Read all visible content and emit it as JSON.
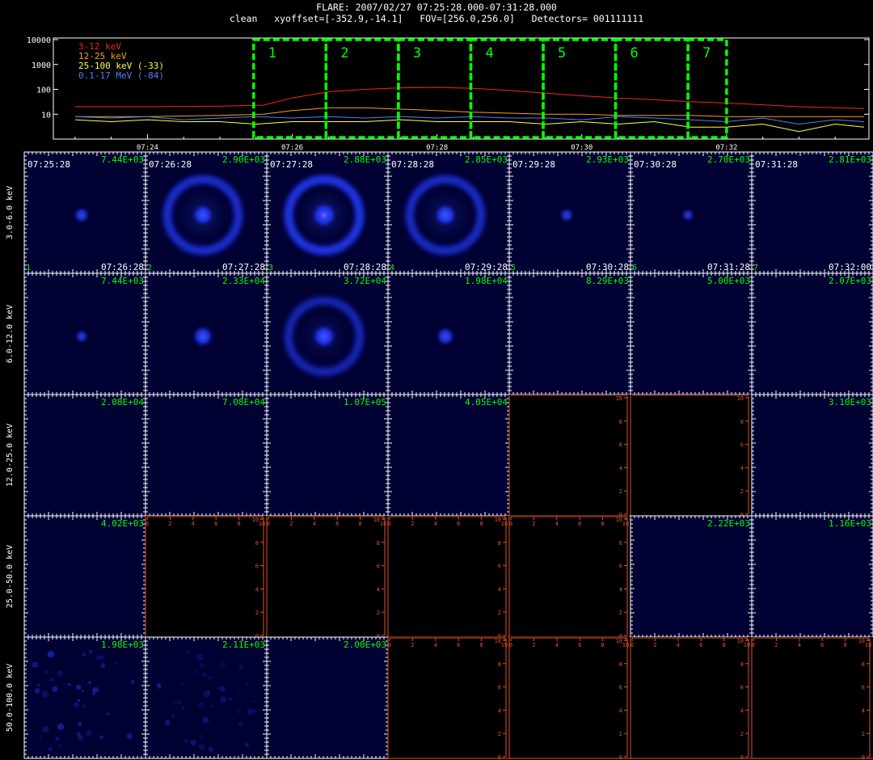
{
  "header": {
    "title": "FLARE: 2007/02/27 07:25:28.000-07:31:28.000",
    "subtitle": "clean   xyoffset=[-352.9,-14.1]   FOV=[256.0,256.0]   Detectors= 001111111"
  },
  "colors": {
    "background": "#000000",
    "panel_bg": "#000033",
    "empty_axis": "#e0522a",
    "interval_box": "#00ff00",
    "peak_label": "#00ff00",
    "time_label": "#ffffff"
  },
  "chart_data": [
    {
      "type": "line",
      "name": "lightcurve",
      "y_scale": "log",
      "ylim": [
        1,
        10000
      ],
      "y_ticks": [
        "10000",
        "1000",
        "100",
        "10"
      ],
      "x_ticks": [
        "07:24",
        "07:26",
        "07:28",
        "07:30",
        "07:32"
      ],
      "legend_placement": "top-left",
      "series": [
        {
          "name": "3-12 keV",
          "color": "#ff2020",
          "x": [
            "07:23.0",
            "07:24.0",
            "07:25.0",
            "07:25.6",
            "07:26.0",
            "07:26.5",
            "07:27.0",
            "07:27.5",
            "07:28.0",
            "07:28.5",
            "07:29.0",
            "07:29.5",
            "07:30.0",
            "07:30.5",
            "07:31.0",
            "07:31.5",
            "07:32.0",
            "07:32.5",
            "07:33.0",
            "07:33.9"
          ],
          "y": [
            20,
            20,
            21,
            23,
            45,
            80,
            100,
            115,
            120,
            110,
            90,
            70,
            55,
            45,
            38,
            32,
            28,
            24,
            20,
            17
          ]
        },
        {
          "name": "12-25 keV",
          "color": "#f0a020",
          "x": [
            "07:23.0",
            "07:24.0",
            "07:25.0",
            "07:25.6",
            "07:26.0",
            "07:26.5",
            "07:27.0",
            "07:27.5",
            "07:28.0",
            "07:28.5",
            "07:29.0",
            "07:29.5",
            "07:30.0",
            "07:30.5",
            "07:31.0",
            "07:31.5",
            "07:32.0",
            "07:32.5",
            "07:33.0",
            "07:33.9"
          ],
          "y": [
            8,
            8,
            9,
            10,
            14,
            18,
            18,
            16,
            14,
            12,
            11,
            10,
            10,
            9,
            9,
            9,
            8,
            8,
            8,
            8
          ]
        },
        {
          "name": "25-100 keV (-33)",
          "color": "#ffff40",
          "x": [
            "07:23.0",
            "07:23.5",
            "07:24.0",
            "07:24.5",
            "07:25.0",
            "07:25.5",
            "07:26.0",
            "07:26.5",
            "07:27.0",
            "07:27.5",
            "07:28.0",
            "07:28.5",
            "07:29.0",
            "07:29.5",
            "07:30.0",
            "07:30.5",
            "07:31.0",
            "07:31.5",
            "07:32.0",
            "07:32.5",
            "07:33.0",
            "07:33.5",
            "07:33.9"
          ],
          "y": [
            6,
            5,
            6,
            5,
            5,
            4,
            5,
            5,
            5,
            6,
            5,
            5,
            5,
            4,
            5,
            4,
            5,
            3,
            3,
            4,
            2,
            4,
            3
          ]
        },
        {
          "name": "0.1-17 MeV (-84)",
          "color": "#4a80ff",
          "x": [
            "07:23.0",
            "07:23.5",
            "07:24.0",
            "07:24.5",
            "07:25.0",
            "07:25.5",
            "07:26.0",
            "07:26.5",
            "07:27.0",
            "07:27.5",
            "07:28.0",
            "07:28.5",
            "07:29.0",
            "07:29.5",
            "07:30.0",
            "07:30.5",
            "07:31.0",
            "07:31.5",
            "07:32.0",
            "07:32.5",
            "07:33.0",
            "07:33.5",
            "07:33.9"
          ],
          "y": [
            8,
            7,
            8,
            6,
            7,
            8,
            7,
            8,
            7,
            8,
            7,
            8,
            7,
            7,
            6,
            8,
            7,
            6,
            5,
            7,
            4,
            6,
            5
          ]
        }
      ],
      "intervals": [
        {
          "label": "1",
          "start": "07:25:28",
          "end": "07:26:28"
        },
        {
          "label": "2",
          "start": "07:26:28",
          "end": "07:27:28"
        },
        {
          "label": "3",
          "start": "07:27:28",
          "end": "07:28:28"
        },
        {
          "label": "4",
          "start": "07:28:28",
          "end": "07:29:28"
        },
        {
          "label": "5",
          "start": "07:29:28",
          "end": "07:30:28"
        },
        {
          "label": "6",
          "start": "07:30:28",
          "end": "07:31:28"
        },
        {
          "label": "7",
          "start": "07:31:28",
          "end": "07:32:00"
        }
      ]
    },
    {
      "type": "heatmap",
      "name": "image_grid",
      "rows": [
        "3.0-6.0 keV",
        "6.0-12.0 keV",
        "12.0-25.0 keV",
        "25.0-50.0 keV",
        "50.0-100.0 keV"
      ],
      "columns": [
        "07:25:28",
        "07:26:28",
        "07:27:28",
        "07:28:28",
        "07:29:28",
        "07:30:28",
        "07:31:28"
      ],
      "end_times": [
        "07:26:28",
        "07:27:28",
        "07:28:28",
        "07:29:28",
        "07:30:28",
        "07:31:28",
        "07:32:00"
      ],
      "interval_numbers": [
        "1",
        "2",
        "3",
        "4",
        "5",
        "6",
        "7"
      ],
      "empty_axis_ticks": [
        "0",
        "2",
        "4",
        "6",
        "8",
        "10"
      ],
      "cells": [
        [
          {
            "peak": "7.44E+03",
            "src": 0.45,
            "ring": 0
          },
          {
            "peak": "2.90E+03",
            "src": 0.8,
            "ring": 0.75
          },
          {
            "peak": "2.88E+03",
            "src": 1.0,
            "ring": 0.9
          },
          {
            "peak": "2.85E+03",
            "src": 0.85,
            "ring": 0.7
          },
          {
            "peak": "2.93E+03",
            "src": 0.35,
            "ring": 0
          },
          {
            "peak": "2.70E+03",
            "src": 0.25,
            "ring": 0
          },
          {
            "peak": "2.81E+03",
            "src": 0,
            "ring": 0
          }
        ],
        [
          {
            "peak": "7.44E+03",
            "src": 0.3,
            "ring": 0
          },
          {
            "peak": "2.33E+04",
            "src": 0.75,
            "ring": 0
          },
          {
            "peak": "3.72E+04",
            "src": 0.9,
            "ring": 0.6
          },
          {
            "peak": "1.98E+04",
            "src": 0.6,
            "ring": 0
          },
          {
            "peak": "8.29E+03",
            "src": 0,
            "ring": 0
          },
          {
            "peak": "5.00E+03",
            "src": 0,
            "ring": 0
          },
          {
            "peak": "2.07E+03",
            "src": 0,
            "ring": 0
          }
        ],
        [
          {
            "peak": "2.08E+04",
            "src": 0,
            "ring": 0
          },
          {
            "peak": "7.08E+04",
            "src": 0,
            "ring": 0
          },
          {
            "peak": "1.07E+05",
            "src": 0,
            "ring": 0
          },
          {
            "peak": "4.05E+04",
            "src": 0,
            "ring": 0
          },
          {
            "empty": true
          },
          {
            "empty": true
          },
          {
            "peak": "3.10E+03",
            "src": 0,
            "ring": 0
          }
        ],
        [
          {
            "peak": "4.02E+03",
            "src": 0,
            "ring": 0
          },
          {
            "empty": true
          },
          {
            "empty": true
          },
          {
            "empty": true
          },
          {
            "empty": true
          },
          {
            "peak": "2.22E+03",
            "src": 0,
            "ring": 0
          },
          {
            "peak": "1.16E+03",
            "src": 0,
            "ring": 0
          }
        ],
        [
          {
            "peak": "1.98E+03",
            "src": 0,
            "ring": 0,
            "noise": 1
          },
          {
            "peak": "2.11E+03",
            "src": 0,
            "ring": 0,
            "noise": 0.6
          },
          {
            "peak": "2.00E+03",
            "src": 0,
            "ring": 0
          },
          {
            "empty": true
          },
          {
            "empty": true
          },
          {
            "empty": true
          },
          {
            "empty": true
          }
        ]
      ]
    }
  ]
}
